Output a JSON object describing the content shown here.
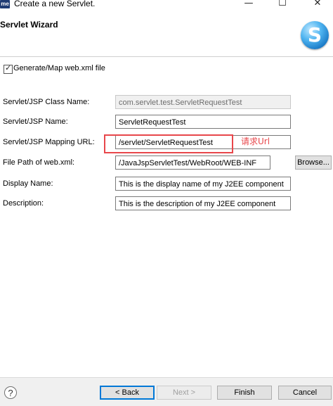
{
  "window": {
    "app_icon": "me",
    "title": "Create a new Servlet.",
    "minimize_glyph": "—",
    "maximize_glyph": "☐",
    "close_glyph": "✕"
  },
  "header": {
    "title": "Servlet Wizard",
    "logo_letter": "S"
  },
  "form": {
    "generate_checkbox_label": "Generate/Map web.xml file",
    "generate_checked": true,
    "class_name": {
      "label": "Servlet/JSP Class Name:",
      "value": "com.servlet.test.ServletRequestTest"
    },
    "servlet_name": {
      "label": "Servlet/JSP Name:",
      "value": "ServletRequestTest"
    },
    "mapping_url": {
      "label": "Servlet/JSP Mapping URL:",
      "value": "/servlet/ServletRequestTest"
    },
    "file_path": {
      "label": "File Path of web.xml:",
      "value": "/JavaJspServletTest/WebRoot/WEB-INF"
    },
    "browse_label": "Browse...",
    "display_name": {
      "label": "Display Name:",
      "value": "This is the display name of my J2EE component"
    },
    "description": {
      "label": "Description:",
      "value": "This is the description of my J2EE component"
    }
  },
  "annotation": {
    "text": "请求Url",
    "color": "#e8474b"
  },
  "footer": {
    "help_glyph": "?",
    "back_label": "< Back",
    "next_label": "Next >",
    "finish_label": "Finish",
    "cancel_label": "Cancel"
  }
}
